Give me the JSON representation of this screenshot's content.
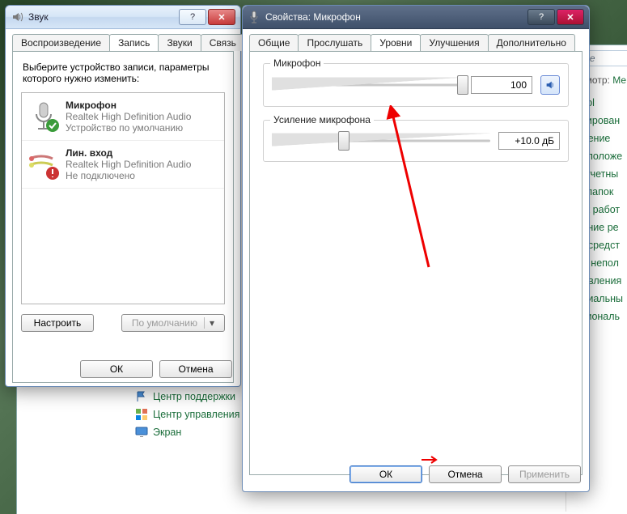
{
  "sound_window": {
    "title": "Звук",
    "tabs": [
      "Воспроизведение",
      "Запись",
      "Звуки",
      "Связь"
    ],
    "active_tab": 1,
    "description": "Выберите устройство записи, параметры которого нужно изменить:",
    "devices": [
      {
        "name": "Микрофон",
        "maker": "Realtek High Definition Audio",
        "status": "Устройство по умолчанию",
        "state": "ok"
      },
      {
        "name": "Лин. вход",
        "maker": "Realtek High Definition Audio",
        "status": "Не подключено",
        "state": "off"
      }
    ],
    "configure_btn": "Настроить",
    "default_btn": "По умолчанию",
    "ok": "ОК",
    "cancel": "Отмена"
  },
  "props_window": {
    "title": "Свойства: Микрофон",
    "tabs": [
      "Общие",
      "Прослушать",
      "Уровни",
      "Улучшения",
      "Дополнительно"
    ],
    "active_tab": 2,
    "groups": {
      "mic": {
        "label": "Микрофон",
        "value": "100",
        "pos": 100
      },
      "boost": {
        "label": "Усиление микрофона",
        "value": "+10.0 дБ",
        "pos": 33
      }
    },
    "ok": "ОК",
    "cancel": "Отмена",
    "apply": "Применить"
  },
  "explorer": {
    "search_placeholder": "оиск в пане",
    "view_label": "мотр:",
    "view_value": "Ме",
    "cat_links": [
      {
        "icon": "flag",
        "label": "Центр поддержки"
      },
      {
        "icon": "grid",
        "label": "Центр управления"
      },
      {
        "icon": "screen",
        "label": "Экран"
      }
    ],
    "right_links": [
      "l Tool",
      "стрирован",
      "овление",
      "расположе",
      "ер учетны",
      "ры папок",
      "ла к работ",
      "авание ре",
      "и и средст",
      "ние непол",
      "бновления",
      "сециальны",
      "региональ"
    ]
  }
}
